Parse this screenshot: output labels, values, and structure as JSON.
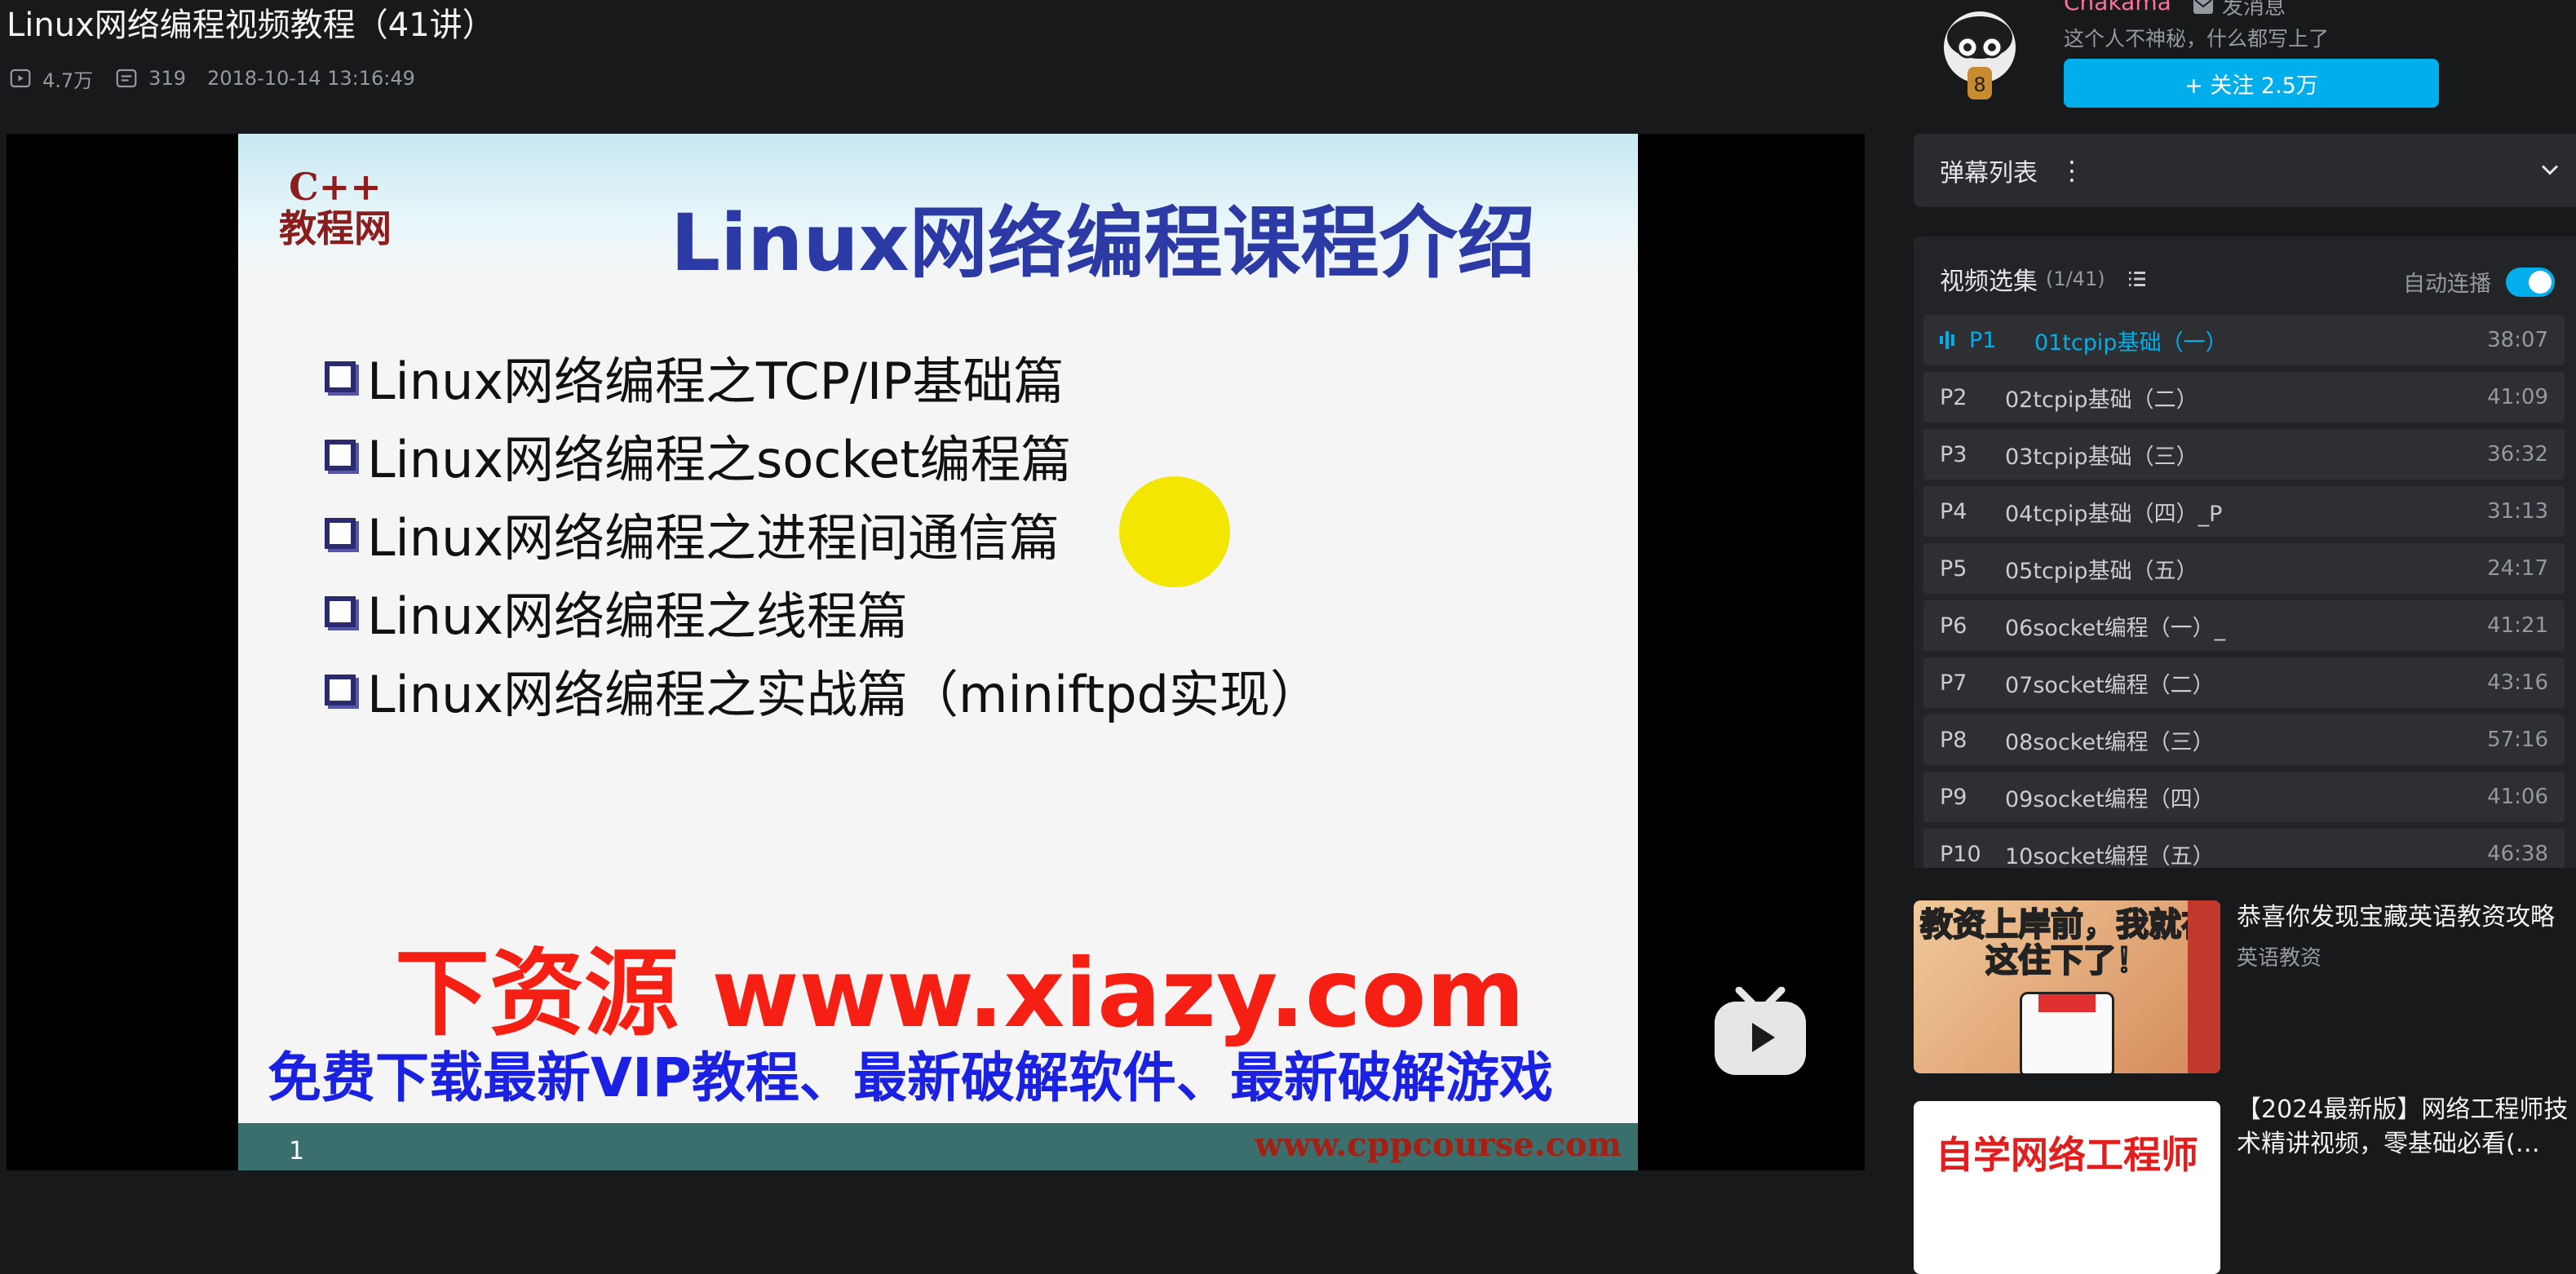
{
  "video": {
    "title": "Linux网络编程视频教程（41讲）",
    "views": "4.7万",
    "danmaku_count": "319",
    "pubdate": "2018-10-14 13:16:49"
  },
  "up": {
    "name": "Chakama",
    "message_label": "发消息",
    "sign": "这个人不神秘，什么都写上了",
    "follow_label": "+ 关注 2.5万"
  },
  "slide": {
    "logo_line1": "C++",
    "logo_line2": "教程网",
    "title": "Linux网络编程课程介绍",
    "bullets": [
      "Linux网络编程之TCP/IP基础篇",
      "Linux网络编程之socket编程篇",
      "Linux网络编程之进程间通信篇",
      "Linux网络编程之线程篇",
      "Linux网络编程之实战篇（miniftpd实现）"
    ],
    "ad_line1": "下资源 www.xiazy.com",
    "ad_line2": "免费下载最新VIP教程、最新破解软件、最新破解游戏",
    "page_number": "1",
    "footer_url": "www.cppcourse.com"
  },
  "danmaku_panel": {
    "label": "弹幕列表",
    "more": "⋮"
  },
  "playlist": {
    "title": "视频选集",
    "count": "(1/41)",
    "autoplay_label": "自动连播",
    "autoplay_on": true,
    "items": [
      {
        "p": "P1",
        "name": "01tcpip基础（一）",
        "duration": "38:07"
      },
      {
        "p": "P2",
        "name": "02tcpip基础（二）",
        "duration": "41:09"
      },
      {
        "p": "P3",
        "name": "03tcpip基础（三）",
        "duration": "36:32"
      },
      {
        "p": "P4",
        "name": "04tcpip基础（四）_P",
        "duration": "31:13"
      },
      {
        "p": "P5",
        "name": "05tcpip基础（五）",
        "duration": "24:17"
      },
      {
        "p": "P6",
        "name": "06socket编程（一）_",
        "duration": "41:21"
      },
      {
        "p": "P7",
        "name": "07socket编程（二）",
        "duration": "43:16"
      },
      {
        "p": "P8",
        "name": "08socket编程（三）",
        "duration": "57:16"
      },
      {
        "p": "P9",
        "name": "09socket编程（四）",
        "duration": "41:06"
      },
      {
        "p": "P10",
        "name": "10socket编程（五）",
        "duration": "46:38"
      }
    ]
  },
  "recommendations": [
    {
      "title": "恭喜你发现宝藏英语教资攻略",
      "author": "英语教资",
      "thumb_text": "教资上岸前，我就在这住下了！"
    },
    {
      "title": "【2024最新版】网络工程师技术精讲视频，零基础必看(…",
      "thumb_text": "自学网络工程师"
    }
  ],
  "colors": {
    "accent": "#00aeec",
    "up_name": "#fb7299",
    "background": "#18191b"
  }
}
